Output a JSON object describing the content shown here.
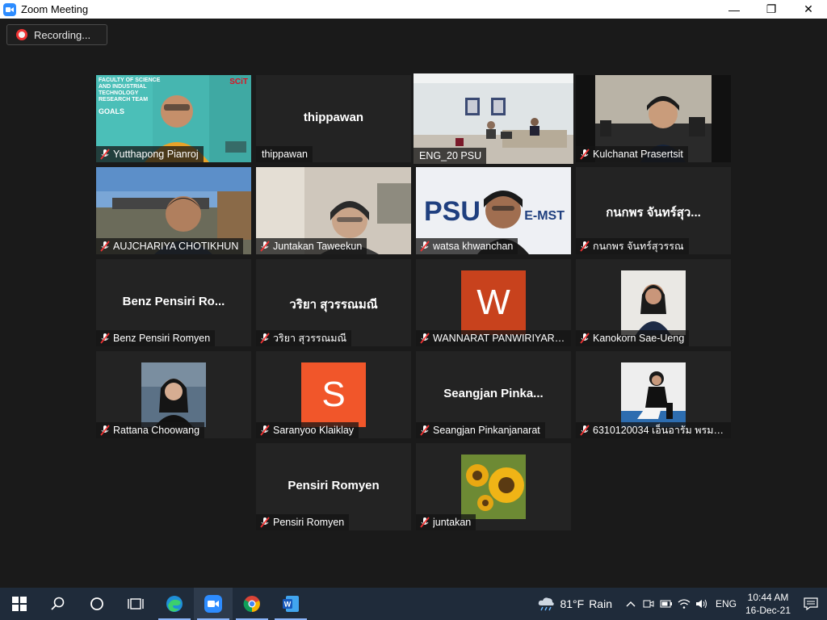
{
  "window": {
    "title": "Zoom Meeting",
    "minimize": "—",
    "maximize": "❐",
    "close": "✕"
  },
  "recording": {
    "label": "Recording..."
  },
  "participants": [
    {
      "name": "Yutthapong Pianroj",
      "display": "video"
    },
    {
      "name": "thippawan",
      "big_name": "thippawan",
      "display": "name"
    },
    {
      "name": "ENG_20 PSU",
      "display": "video",
      "active": true
    },
    {
      "name": "Kulchanat Prasertsit",
      "display": "video"
    },
    {
      "name": "AUJCHARIYA CHOTIKHUN",
      "display": "video"
    },
    {
      "name": "Juntakan  Taweekun",
      "display": "video"
    },
    {
      "name": "watsa khwanchan",
      "display": "video"
    },
    {
      "name": "กนกพร  จันทร์สุวรรณ",
      "big_name": "กนกพร  จันทร์สุว...",
      "display": "name"
    },
    {
      "name": "Benz Pensiri Romyen",
      "big_name": "Benz Pensiri Ro...",
      "display": "name"
    },
    {
      "name": "วริยา สุวรรณมณี",
      "big_name": "วริยา สุวรรณมณี",
      "display": "name"
    },
    {
      "name": "WANNARAT PANWIRIYARAT",
      "avatar_letter": "W",
      "avatar_color": "#c8421d",
      "display": "letter"
    },
    {
      "name": "Kanokorn Sae-Ueng",
      "display": "photo"
    },
    {
      "name": "Rattana Choowang",
      "display": "photo"
    },
    {
      "name": "Saranyoo Klaiklay",
      "avatar_letter": "S",
      "avatar_color": "#f1562a",
      "display": "letter"
    },
    {
      "name": "Seangjan Pinkanjanarat",
      "big_name": "Seangjan  Pinka...",
      "display": "name"
    },
    {
      "name": "6310120034 เอ็นอารัม พรมโน...",
      "display": "photo"
    },
    {
      "name": "Pensiri Romyen",
      "big_name": "Pensiri Romyen",
      "display": "name"
    },
    {
      "name": "juntakan",
      "display": "photo"
    }
  ],
  "slide_text": {
    "line1": "FACULTY OF SCIENCE",
    "line2": "AND INDUSTRIAL",
    "line3": "TECHNOLOGY",
    "line4": "RESEARCH TEAM",
    "logo": "SCiT",
    "goals": "GOALS"
  },
  "psu_banner": {
    "left": "PSU",
    "right": "E-MST"
  },
  "taskbar": {
    "weather_temp": "81°F",
    "weather_desc": "Rain",
    "language": "ENG",
    "time": "10:44 AM",
    "date": "16-Dec-21"
  },
  "colors": {
    "active_speaker": "#c7d825",
    "tile_bg": "#232323",
    "stage_bg": "#1a1a1a",
    "taskbar_bg": "#1f2b3a"
  }
}
